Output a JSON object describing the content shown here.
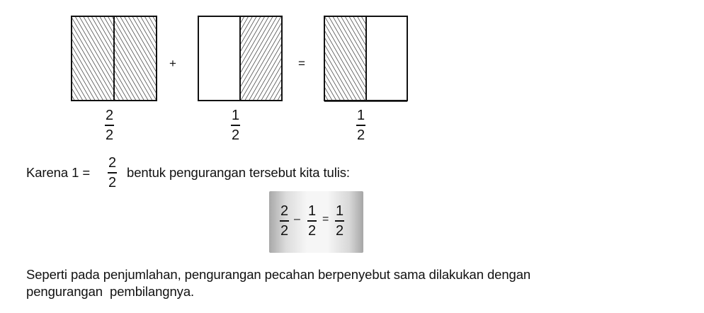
{
  "figures": [
    {
      "name": "figure-whole",
      "shaded": [
        true,
        true
      ],
      "fraction": {
        "numerator": "2",
        "denominator": "2"
      }
    },
    {
      "name": "figure-right-half",
      "shaded": [
        false,
        true
      ],
      "fraction": {
        "numerator": "1",
        "denominator": "2"
      }
    },
    {
      "name": "figure-left-half",
      "shaded": [
        true,
        false
      ],
      "fraction": {
        "numerator": "1",
        "denominator": "2"
      }
    }
  ],
  "operators": {
    "plus": "+",
    "equals": "="
  },
  "sentence1": {
    "prefix": "Karena 1 =",
    "fraction": {
      "numerator": "2",
      "denominator": "2"
    },
    "suffix": "bentuk pengurangan tersebut kita tulis:"
  },
  "equation": {
    "a": {
      "numerator": "2",
      "denominator": "2"
    },
    "minus": "–",
    "b": {
      "numerator": "1",
      "denominator": "2"
    },
    "equals": "=",
    "c": {
      "numerator": "1",
      "denominator": "2"
    }
  },
  "paragraph": {
    "line1": "Seperti pada penjumlahan, pengurangan pecahan berpenyebut sama dilakukan dengan",
    "line2": "pengurangan  pembilangnya."
  },
  "colors": {
    "ink": "#111111",
    "hatch": "#111111",
    "box_edge": "#a6a6a6",
    "box_center": "#f6f6f6"
  }
}
